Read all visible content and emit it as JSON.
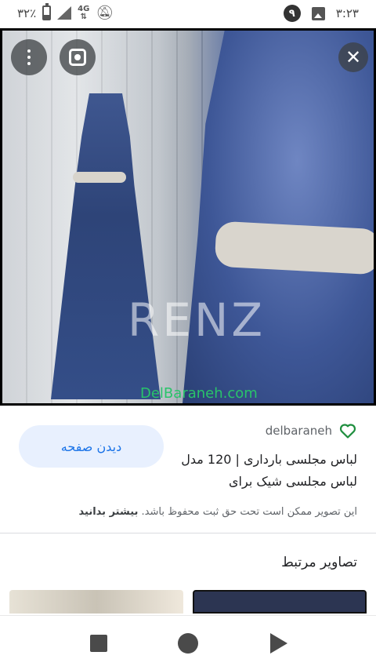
{
  "status_bar": {
    "battery_text": "۳۲٪",
    "battery_level": 0.32,
    "network_type": "4G",
    "notification_count": "۹",
    "time": "۳:۲۳"
  },
  "viewer": {
    "watermark_text": "RENZ",
    "site_watermark": "DelBaraneh.com",
    "icons": [
      "more-vert-icon",
      "lens-icon",
      "close-icon"
    ],
    "close_glyph": "✕"
  },
  "info": {
    "source_name": "delbaraneh",
    "visit_button_label": "دیدن صفحه",
    "title": "لباس مجلسی بارداری | 120 مدل لباس مجلسی شیک برای",
    "copyright_text": "این تصویر ممکن است تحت حق ثبت محفوظ باشد.",
    "learn_more": "بیشتر بدانید",
    "related_title": "تصاویر مرتبط"
  },
  "colors": {
    "accent": "#1a73e8",
    "button_bg": "#e8f0fe",
    "heart": "#1e8e3e",
    "watermark_green": "#29c46a"
  }
}
